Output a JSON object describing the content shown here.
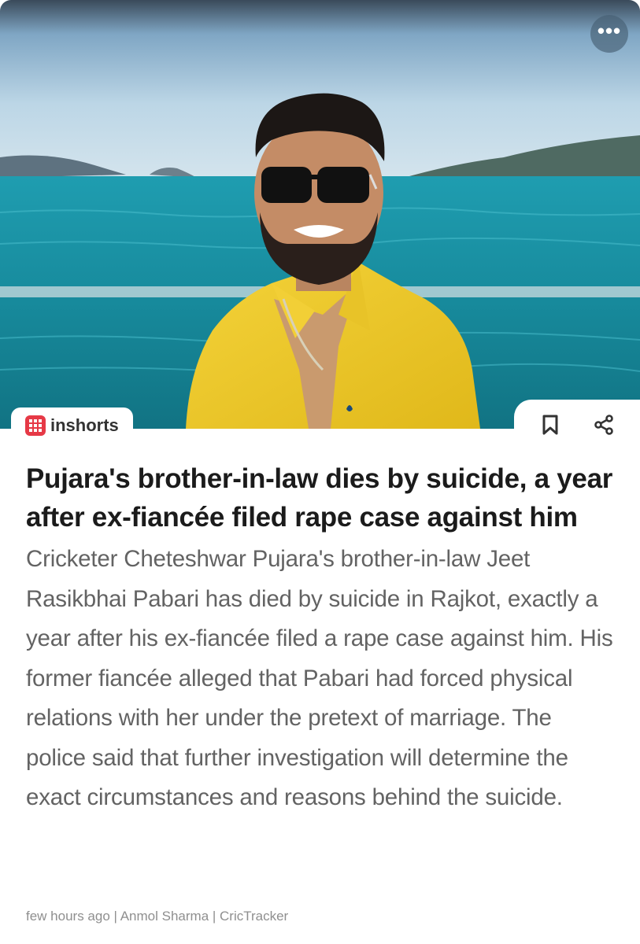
{
  "card": {
    "brand": {
      "name": "inshorts",
      "icon": "inshorts-logo-icon",
      "color": "#e63946"
    },
    "menu": {
      "icon": "more-options-icon",
      "label": "•••"
    },
    "actions": [
      {
        "icon": "bookmark-icon"
      },
      {
        "icon": "share-icon"
      }
    ],
    "headline": "Pujara's brother-in-law dies by suicide, a year after ex-fiancée filed rape case against him",
    "body": "Cricketer Cheteshwar Pujara's brother-in-law Jeet Rasikbhai Pabari has died by suicide in Rajkot, exactly a year after his ex-fiancée filed a rape case against him. His former fiancée alleged that Pabari had forced physical relations with her under the pretext of marriage. The police said that further investigation will determine the exact circumstances and reasons behind the suicide.",
    "meta": "few hours ago | Anmol Sharma | CricTracker"
  }
}
